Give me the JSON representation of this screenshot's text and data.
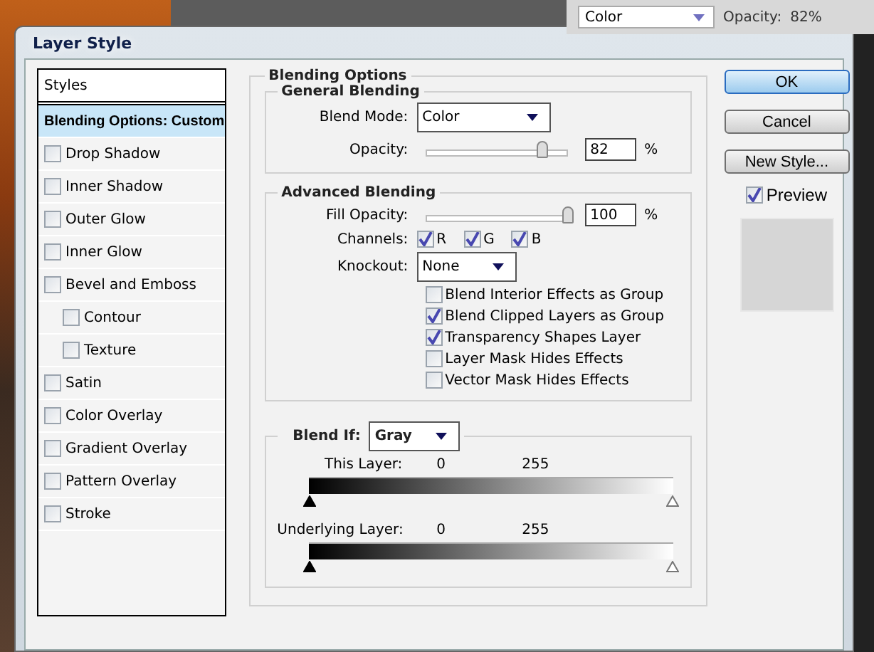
{
  "background": {
    "blend_mode": "Color",
    "opacity_label": "Opacity:",
    "opacity_value": "82%"
  },
  "window": {
    "title": "Layer Style"
  },
  "styles": {
    "header": "Styles",
    "items": [
      {
        "label": "Blending Options: Custom",
        "kind": "heading",
        "selected": true
      },
      {
        "label": "Drop Shadow",
        "kind": "checkbox",
        "checked": false,
        "selected": false
      },
      {
        "label": "Inner Shadow",
        "kind": "checkbox",
        "checked": false,
        "selected": false
      },
      {
        "label": "Outer Glow",
        "kind": "checkbox",
        "checked": false,
        "selected": false
      },
      {
        "label": "Inner Glow",
        "kind": "checkbox",
        "checked": false,
        "selected": false
      },
      {
        "label": "Bevel and Emboss",
        "kind": "checkbox",
        "checked": false,
        "selected": false,
        "children": [
          {
            "label": "Contour",
            "kind": "checkbox",
            "checked": false,
            "selected": false
          },
          {
            "label": "Texture",
            "kind": "checkbox",
            "checked": false,
            "selected": false
          }
        ]
      },
      {
        "label": "Satin",
        "kind": "checkbox",
        "checked": false,
        "selected": false
      },
      {
        "label": "Color Overlay",
        "kind": "checkbox",
        "checked": false,
        "selected": false
      },
      {
        "label": "Gradient Overlay",
        "kind": "checkbox",
        "checked": false,
        "selected": false
      },
      {
        "label": "Pattern Overlay",
        "kind": "checkbox",
        "checked": false,
        "selected": false
      },
      {
        "label": "Stroke",
        "kind": "checkbox",
        "checked": false,
        "selected": false
      }
    ]
  },
  "blending_options": {
    "title": "Blending Options",
    "general": {
      "title": "General Blending",
      "blend_mode": {
        "label": "Blend Mode:",
        "value": "Color"
      },
      "opacity": {
        "label": "Opacity:",
        "level": 0.82,
        "value": "82",
        "unit": "%"
      }
    },
    "advanced": {
      "title": "Advanced Blending",
      "fill_opacity": {
        "label": "Fill Opacity:",
        "level": 1,
        "value": "100",
        "unit": "%"
      },
      "channels": {
        "label": "Channels:",
        "items": [
          {
            "label": "R",
            "checked": true
          },
          {
            "label": "G",
            "checked": true
          },
          {
            "label": "B",
            "checked": true
          }
        ]
      },
      "knockout": {
        "label": "Knockout:",
        "value": "None"
      },
      "options": [
        {
          "label": "Blend Interior Effects as Group",
          "checked": false
        },
        {
          "label": "Blend Clipped Layers as Group",
          "checked": true
        },
        {
          "label": "Transparency Shapes Layer",
          "checked": true
        },
        {
          "label": "Layer Mask Hides Effects",
          "checked": false
        },
        {
          "label": "Vector Mask Hides Effects",
          "checked": false
        }
      ]
    },
    "blend_if": {
      "label": "Blend If:",
      "value": "Gray",
      "layers": [
        {
          "label": "This Layer:",
          "low": "0",
          "high": "255",
          "handles": [
            {
              "level": 0
            },
            {
              "level": 1
            }
          ]
        },
        {
          "label": "Underlying Layer:",
          "low": "0",
          "high": "255",
          "handles": [
            {
              "level": 0
            },
            {
              "level": 1
            }
          ]
        }
      ]
    }
  },
  "buttons": [
    {
      "label": "OK",
      "default": true
    },
    {
      "label": "Cancel",
      "default": false
    },
    {
      "label": "New Style...",
      "default": false
    }
  ],
  "preview": {
    "label": "Preview",
    "checked": true
  }
}
